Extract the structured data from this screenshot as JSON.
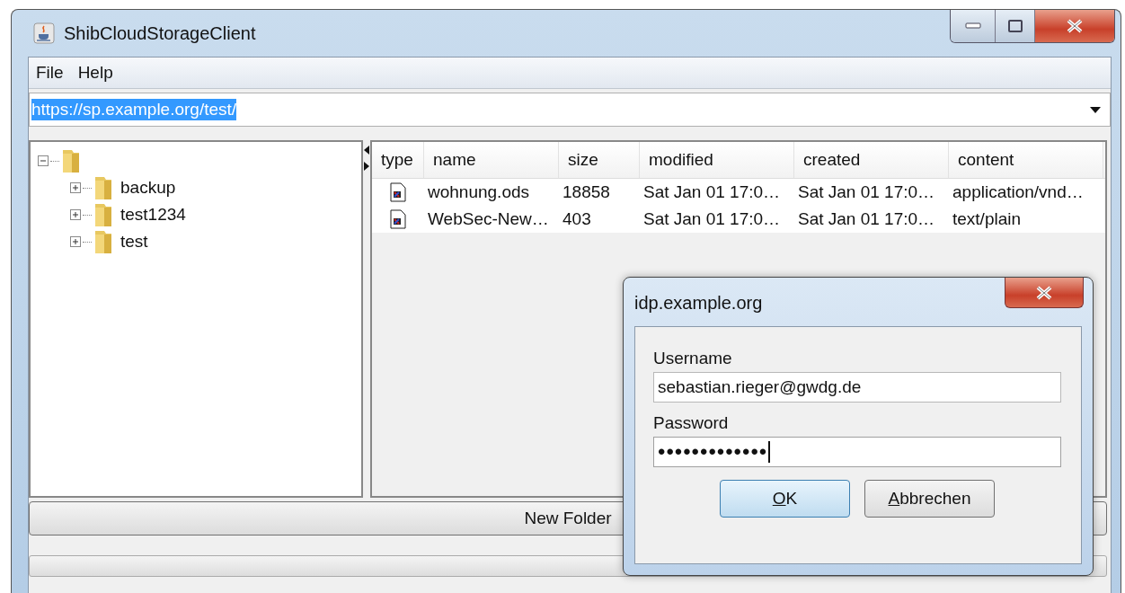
{
  "window": {
    "title": "ShibCloudStorageClient"
  },
  "menu": [
    "File",
    "Help"
  ],
  "url_field": {
    "value": "https://sp.example.org/test/",
    "text_selected": true
  },
  "tree": {
    "expanded": true,
    "children": [
      {
        "label": "backup",
        "expanded": false
      },
      {
        "label": "test1234",
        "expanded": false
      },
      {
        "label": "test",
        "expanded": false
      }
    ]
  },
  "table": {
    "columns": [
      "type",
      "name",
      "size",
      "modified",
      "created",
      "content"
    ],
    "rows": [
      {
        "name": "wohnung.ods",
        "size": "18858",
        "modified": "Sat Jan 01 17:0…",
        "created": "Sat Jan 01 17:0…",
        "content": "application/vnd…"
      },
      {
        "name": "WebSec-New…",
        "size": "403",
        "modified": "Sat Jan 01 17:0…",
        "created": "Sat Jan 01 17:0…",
        "content": "text/plain"
      }
    ]
  },
  "new_folder_button": "New Folder",
  "progress": {
    "level": 0
  },
  "dialog": {
    "title": "idp.example.org",
    "fields": [
      {
        "kind": "text",
        "label": "Username",
        "value": "sebastian.rieger@gwdg.de",
        "focused": false
      },
      {
        "kind": "password",
        "label": "Password",
        "value": "•••••••••••••",
        "focused": true
      }
    ],
    "buttons": [
      {
        "label": "OK",
        "default": true,
        "mnemonic": true
      },
      {
        "label": "Abbrechen",
        "default": false,
        "mnemonic": true
      }
    ]
  }
}
